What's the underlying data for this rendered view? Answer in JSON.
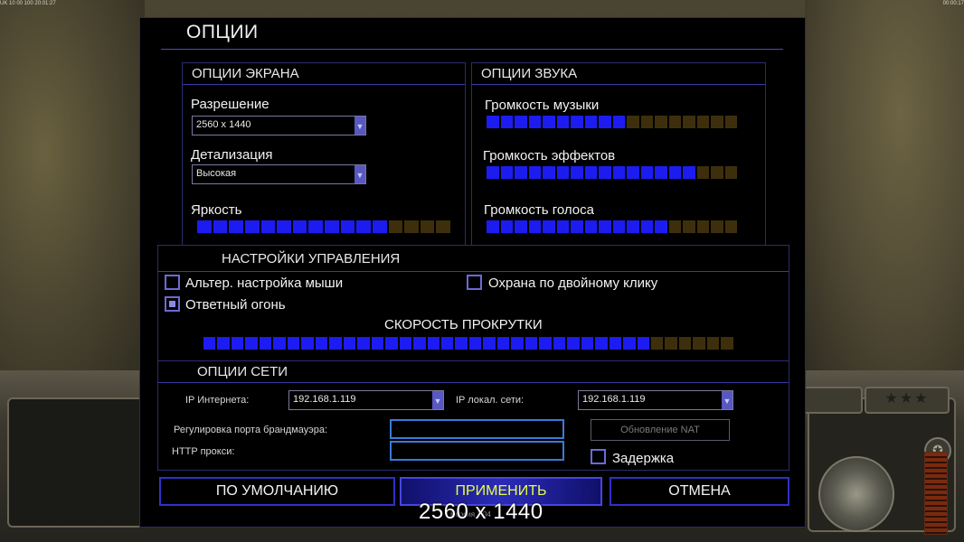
{
  "dialog": {
    "title": "ОПЦИИ"
  },
  "screen_options": {
    "header": "ОПЦИИ ЭКРАНА",
    "resolution_label": "Разрешение",
    "resolution_value": "2560 x 1440",
    "detail_label": "Детализация",
    "detail_value": "Высокая",
    "brightness_label": "Яркость",
    "brightness": {
      "filled": 12,
      "total": 16
    }
  },
  "sound_options": {
    "header": "ОПЦИИ ЗВУКА",
    "music_label": "Громкость музыки",
    "music": {
      "filled": 10,
      "total": 18
    },
    "effects_label": "Громкость эффектов",
    "effects": {
      "filled": 15,
      "total": 18
    },
    "voice_label": "Громкость голоса",
    "voice": {
      "filled": 13,
      "total": 18
    }
  },
  "control_settings": {
    "header": "НАСТРОЙКИ УПРАВЛЕНИЯ",
    "alt_mouse_label": "Альтер. настройка мыши",
    "alt_mouse_checked": false,
    "double_click_guard_label": "Охрана по двойному клику",
    "double_click_guard_checked": false,
    "return_fire_label": "Ответный огонь",
    "return_fire_checked": true,
    "scroll_speed_label": "СКОРОСТЬ ПРОКРУТКИ",
    "scroll_speed": {
      "filled": 32,
      "total": 38
    }
  },
  "network_options": {
    "header": "ОПЦИИ СЕТИ",
    "internet_ip_label": "IP Интернета:",
    "internet_ip_value": "192.168.1.119",
    "lan_ip_label": "IP локал. сети:",
    "lan_ip_value": "192.168.1.119",
    "firewall_port_label": "Регулировка порта брандмауэра:",
    "firewall_port_value": "",
    "http_proxy_label": "HTTP прокси:",
    "http_proxy_value": "",
    "nat_refresh_label": "Обновление NAT",
    "delay_label": "Задержка",
    "delay_checked": false
  },
  "buttons": {
    "defaults": "ПО УМОЛЧАНИЮ",
    "apply": "ПРИМЕНИТЬ",
    "cancel": "ОТМЕНА"
  },
  "overlay": {
    "resolution_text": "2560 x 1440",
    "version_text": "Версия 1.04"
  },
  "hud": {
    "top_left_text": "UK 10 00 100 20:01:27",
    "top_right_text": "00:00:17",
    "stars": "★★★"
  },
  "colors": {
    "slider_on": "#1c1cf0",
    "slider_off": "#3e2f0c",
    "panel_border": "#2c2c6e",
    "apply_text": "#e6ff4a"
  }
}
